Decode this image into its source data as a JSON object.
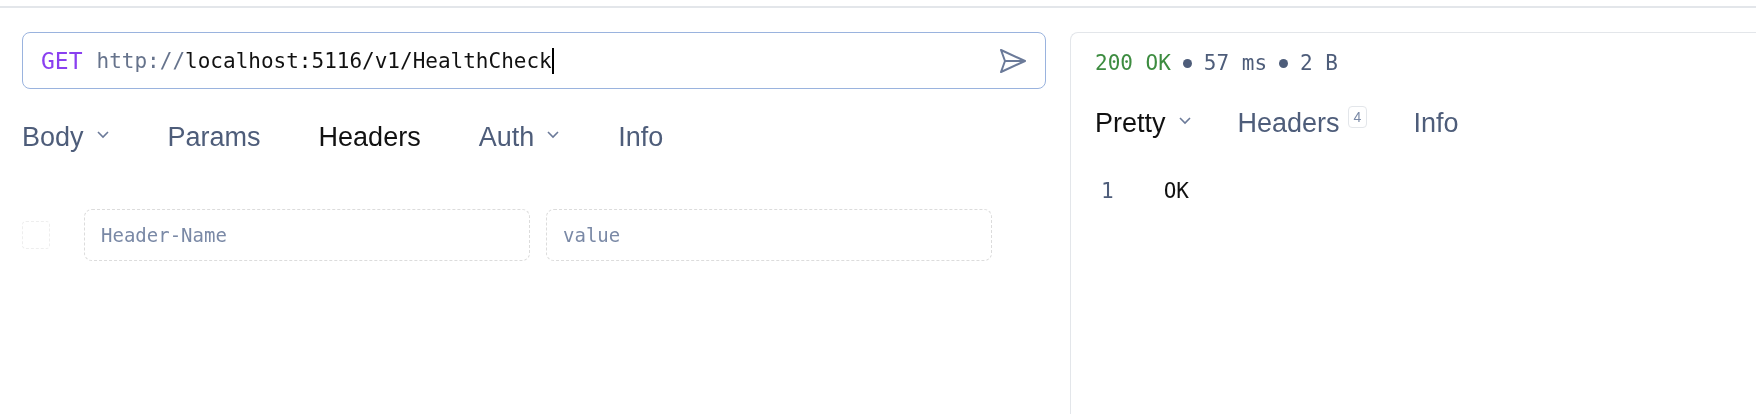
{
  "request": {
    "method": "GET",
    "url_scheme": "http://",
    "url_rest": "localhost:5116/v1/HealthCheck"
  },
  "request_tabs": [
    {
      "label": "Body",
      "dropdown": true,
      "selected": false
    },
    {
      "label": "Params",
      "dropdown": false,
      "selected": false
    },
    {
      "label": "Headers",
      "dropdown": false,
      "selected": true
    },
    {
      "label": "Auth",
      "dropdown": true,
      "selected": false
    },
    {
      "label": "Info",
      "dropdown": false,
      "selected": false
    }
  ],
  "header_row": {
    "checked": false,
    "name_placeholder": "Header-Name",
    "value_placeholder": "value"
  },
  "response": {
    "status": "200 OK",
    "time": "57 ms",
    "size": "2 B",
    "tabs": [
      {
        "label": "Pretty",
        "dropdown": true,
        "selected": true
      },
      {
        "label": "Headers",
        "dropdown": false,
        "selected": false,
        "count": "4"
      },
      {
        "label": "Info",
        "dropdown": false,
        "selected": false
      }
    ],
    "lines": [
      {
        "number": "1",
        "text": "OK"
      }
    ]
  }
}
